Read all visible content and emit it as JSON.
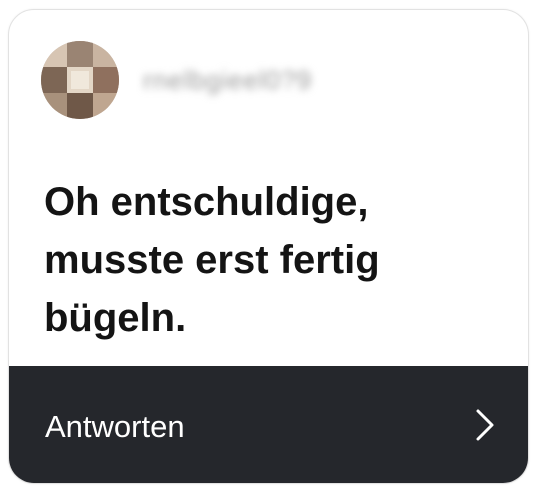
{
  "story_reply": {
    "username": "rnelbgieel0?9",
    "message": "Oh entschuldige, musste erst fertig bügeln.",
    "reply_label": "Antworten",
    "avatar_icon": "user-avatar-pixelated",
    "chevron_icon": "chevron-right-icon"
  },
  "colors": {
    "reply_bar": "#25272c",
    "message_text": "#141414",
    "username_text": "#9a9a9a"
  }
}
